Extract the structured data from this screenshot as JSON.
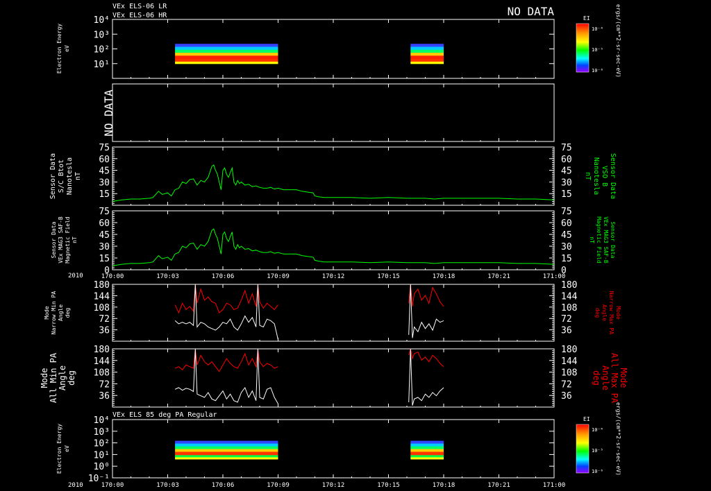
{
  "header": {
    "titles": [
      "VEx ELS-06 LR",
      "VEx ELS-06 HR"
    ],
    "no_data_label": "NO DATA",
    "bottom_title": "VEx ELS 85 deg PA Regular"
  },
  "colors": {
    "background": "#000000",
    "foreground": "#ffffff",
    "mag_trace": "#00ff00",
    "max_pa_trace": "#ff0000",
    "min_pa_trace": "#ffffff"
  },
  "colorbars": {
    "label": "EI",
    "ticks_top": [
      "10⁻⁴",
      "10⁻⁵",
      "10⁻⁶"
    ],
    "ticks_bottom": [
      "10⁻⁴",
      "10⁻⁵",
      "10⁻⁶"
    ],
    "units": "ergs/(cm**2-sr-sec-eV)"
  },
  "time_axis": {
    "year": "2010",
    "ticks": [
      "170:00",
      "170:03",
      "170:06",
      "170:09",
      "170:12",
      "170:15",
      "170:18",
      "170:21",
      "171:00"
    ]
  },
  "chart_data": [
    {
      "id": "els-lr-hr",
      "type": "heatmap",
      "ylabel": [
        "Electron Energy",
        "eV"
      ],
      "ytick_labels": [
        "10⁴",
        "10³",
        "10²",
        "10¹"
      ],
      "ylim": [
        1,
        10000
      ],
      "ylog": true,
      "blocks": [
        {
          "t_start": 3.4,
          "t_end": 9.0,
          "e_min": 10,
          "e_max": 220
        },
        {
          "t_start": 16.2,
          "t_end": 18.0,
          "e_min": 10,
          "e_max": 220
        }
      ]
    },
    {
      "id": "no-data-panel",
      "type": "table",
      "ylabel": [
        "NO DATA"
      ],
      "values": []
    },
    {
      "id": "sc-btot",
      "type": "line",
      "ylabel": [
        "Sensor Data",
        "S/C Btot",
        "Nanotesla",
        "nT"
      ],
      "ylabel_right": [
        "Sensor Data",
        "VSO B",
        "Nanotesla",
        "nT"
      ],
      "ytick_labels_left": [
        "75",
        "60",
        "45",
        "30",
        "15"
      ],
      "ytick_labels_right": [
        "75",
        "60",
        "45",
        "30",
        "15"
      ],
      "ylim": [
        0,
        75
      ],
      "x": [
        0,
        0.5,
        1,
        1.5,
        2,
        2.2,
        2.5,
        2.7,
        3,
        3.2,
        3.4,
        3.6,
        3.8,
        4,
        4.2,
        4.4,
        4.6,
        4.8,
        5,
        5.2,
        5.4,
        5.5,
        5.6,
        5.7,
        5.8,
        5.9,
        6,
        6.1,
        6.2,
        6.3,
        6.4,
        6.5,
        6.6,
        6.7,
        6.8,
        6.9,
        7,
        7.2,
        7.4,
        7.6,
        7.8,
        8,
        8.2,
        8.4,
        8.6,
        8.8,
        9,
        9.3,
        9.6,
        10,
        10.3,
        10.6,
        10.9,
        11,
        11.2,
        11.5,
        12,
        13,
        14,
        15,
        16,
        16.5,
        17,
        17.5,
        18,
        19,
        20,
        21,
        22,
        23,
        24
      ],
      "values": [
        5,
        7,
        8,
        8,
        9,
        10,
        18,
        14,
        16,
        12,
        20,
        22,
        30,
        28,
        33,
        34,
        26,
        32,
        30,
        36,
        50,
        52,
        45,
        40,
        30,
        20,
        45,
        48,
        40,
        36,
        42,
        48,
        30,
        26,
        32,
        28,
        30,
        26,
        27,
        24,
        25,
        23,
        22,
        22,
        23,
        21,
        22,
        20,
        20,
        20,
        18,
        17,
        16,
        12,
        11,
        10,
        10,
        10,
        9,
        10,
        9,
        9,
        9,
        8,
        9,
        9,
        9,
        9,
        8,
        8,
        7
      ]
    },
    {
      "id": "mag-saf-b",
      "type": "line",
      "ylabel": [
        "Sensor Data",
        "VEx MAG3 SAF-B",
        "Magnetic Field",
        "nT"
      ],
      "ylabel_right": [
        "Sensor Data",
        "VEx MAG3 SAF-B",
        "Magnetic Field",
        "nT"
      ],
      "ytick_labels_left": [
        "75",
        "60",
        "45",
        "30",
        "15",
        "0"
      ],
      "ytick_labels_right": [
        "75",
        "60",
        "45",
        "30",
        "15",
        "0"
      ],
      "ylim": [
        0,
        75
      ],
      "x": [
        0,
        0.5,
        1,
        1.5,
        2,
        2.2,
        2.5,
        2.7,
        3,
        3.2,
        3.4,
        3.6,
        3.8,
        4,
        4.2,
        4.4,
        4.6,
        4.8,
        5,
        5.2,
        5.4,
        5.5,
        5.6,
        5.7,
        5.8,
        5.9,
        6,
        6.1,
        6.2,
        6.3,
        6.4,
        6.5,
        6.6,
        6.7,
        6.8,
        6.9,
        7,
        7.2,
        7.4,
        7.6,
        7.8,
        8,
        8.2,
        8.4,
        8.6,
        8.8,
        9,
        9.3,
        9.6,
        10,
        10.3,
        10.6,
        10.9,
        11,
        11.2,
        11.5,
        12,
        13,
        14,
        15,
        16,
        16.5,
        17,
        17.5,
        18,
        19,
        20,
        21,
        22,
        23,
        24
      ],
      "values": [
        5,
        7,
        8,
        8,
        9,
        10,
        18,
        14,
        16,
        12,
        20,
        22,
        30,
        28,
        33,
        34,
        26,
        32,
        30,
        36,
        50,
        52,
        45,
        40,
        30,
        20,
        45,
        48,
        40,
        36,
        42,
        48,
        30,
        26,
        32,
        28,
        30,
        26,
        27,
        24,
        25,
        23,
        22,
        22,
        23,
        21,
        22,
        20,
        20,
        20,
        18,
        17,
        16,
        12,
        11,
        10,
        10,
        10,
        9,
        10,
        9,
        9,
        9,
        8,
        9,
        9,
        9,
        9,
        8,
        8,
        7
      ]
    },
    {
      "id": "narrow-pa",
      "type": "line",
      "ylabel": [
        "Mode",
        "Narrow Min PA",
        "Angle",
        "deg"
      ],
      "ylabel_right": [
        "Mode",
        "Narrow Max PA",
        "Angle",
        "deg"
      ],
      "ytick_labels_left": [
        "180",
        "144",
        "108",
        "72",
        "36"
      ],
      "ytick_labels_right": [
        "180",
        "144",
        "108",
        "72",
        "36"
      ],
      "ylim": [
        0,
        180
      ],
      "series": [
        {
          "name": "Narrow Max PA",
          "segments": [
            {
              "x": [
                3.4,
                3.6,
                3.8,
                4.0,
                4.2,
                4.4,
                4.5,
                4.6,
                4.8,
                5.0,
                5.2,
                5.4,
                5.6,
                5.8,
                6.0,
                6.2,
                6.4,
                6.6,
                6.8,
                7.0,
                7.2,
                7.4,
                7.6,
                7.8,
                7.9,
                8.0,
                8.2,
                8.4,
                8.6,
                8.8,
                9.0
              ],
              "values": [
                115,
                90,
                120,
                100,
                110,
                95,
                180,
                120,
                165,
                130,
                140,
                125,
                120,
                90,
                100,
                120,
                115,
                100,
                105,
                130,
                160,
                120,
                150,
                110,
                180,
                125,
                105,
                120,
                110,
                100,
                115
              ]
            },
            {
              "x": [
                16.1,
                16.2,
                16.3,
                16.4,
                16.6,
                16.8,
                17.0,
                17.2,
                17.4,
                17.6,
                17.8,
                18.0
              ],
              "values": [
                120,
                180,
                110,
                150,
                165,
                130,
                145,
                120,
                170,
                150,
                125,
                110
              ]
            }
          ]
        },
        {
          "name": "Narrow Min PA",
          "segments": [
            {
              "x": [
                3.4,
                3.6,
                3.8,
                4.0,
                4.2,
                4.4,
                4.5,
                4.6,
                4.8,
                5.0,
                5.2,
                5.4,
                5.6,
                5.8,
                6.0,
                6.2,
                6.4,
                6.6,
                6.8,
                7.0,
                7.2,
                7.4,
                7.6,
                7.8,
                7.9,
                8.0,
                8.2,
                8.4,
                8.6,
                8.8,
                9.0
              ],
              "values": [
                65,
                55,
                60,
                55,
                60,
                50,
                180,
                45,
                60,
                55,
                45,
                40,
                35,
                45,
                60,
                55,
                70,
                45,
                35,
                55,
                80,
                60,
                75,
                45,
                180,
                50,
                45,
                70,
                65,
                55,
                5
              ]
            },
            {
              "x": [
                16.1,
                16.2,
                16.3,
                16.4,
                16.6,
                16.8,
                17.0,
                17.2,
                17.4,
                17.6,
                17.8,
                18.0
              ],
              "values": [
                20,
                180,
                10,
                45,
                30,
                60,
                40,
                55,
                35,
                70,
                60,
                65
              ]
            }
          ]
        }
      ]
    },
    {
      "id": "all-pa",
      "type": "line",
      "ylabel": [
        "Mode",
        "All Min PA",
        "Angle",
        "deg"
      ],
      "ylabel_right": [
        "Mode",
        "All Max PA",
        "Angle",
        "deg"
      ],
      "ytick_labels_left": [
        "180",
        "144",
        "108",
        "72",
        "36"
      ],
      "ytick_labels_right": [
        "180",
        "144",
        "108",
        "72",
        "36"
      ],
      "ylim": [
        0,
        180
      ],
      "series": [
        {
          "name": "All Max PA",
          "segments": [
            {
              "x": [
                3.4,
                3.6,
                3.8,
                4.0,
                4.2,
                4.4,
                4.5,
                4.6,
                4.8,
                5.0,
                5.2,
                5.4,
                5.6,
                5.8,
                6.0,
                6.2,
                6.4,
                6.6,
                6.8,
                7.0,
                7.2,
                7.4,
                7.6,
                7.8,
                7.9,
                8.0,
                8.2,
                8.4,
                8.6,
                8.8,
                9.0
              ],
              "values": [
                120,
                125,
                115,
                130,
                125,
                120,
                180,
                130,
                160,
                140,
                130,
                140,
                125,
                110,
                130,
                150,
                135,
                125,
                120,
                140,
                165,
                130,
                150,
                125,
                180,
                140,
                125,
                135,
                130,
                120,
                125
              ]
            },
            {
              "x": [
                16.1,
                16.2,
                16.3,
                16.4,
                16.6,
                16.8,
                17.0,
                17.2,
                17.4,
                17.6,
                17.8,
                18.0
              ],
              "values": [
                160,
                180,
                150,
                165,
                170,
                145,
                155,
                140,
                160,
                150,
                135,
                125
              ]
            }
          ]
        },
        {
          "name": "All Min PA",
          "segments": [
            {
              "x": [
                3.4,
                3.6,
                3.8,
                4.0,
                4.2,
                4.4,
                4.5,
                4.6,
                4.8,
                5.0,
                5.2,
                5.4,
                5.6,
                5.8,
                6.0,
                6.2,
                6.4,
                6.6,
                6.8,
                7.0,
                7.2,
                7.4,
                7.6,
                7.8,
                7.9,
                8.0,
                8.2,
                8.4,
                8.6,
                8.8,
                9.0
              ],
              "values": [
                55,
                60,
                52,
                58,
                55,
                48,
                180,
                40,
                35,
                30,
                45,
                25,
                20,
                35,
                50,
                25,
                40,
                20,
                15,
                45,
                60,
                30,
                50,
                20,
                180,
                30,
                25,
                55,
                60,
                30,
                10
              ]
            },
            {
              "x": [
                16.1,
                16.2,
                16.3,
                16.4,
                16.6,
                16.8,
                17.0,
                17.2,
                17.4,
                17.6,
                17.8,
                18.0
              ],
              "values": [
                15,
                180,
                5,
                25,
                30,
                20,
                40,
                30,
                45,
                35,
                50,
                60
              ]
            }
          ]
        }
      ]
    },
    {
      "id": "els-85-pa",
      "type": "heatmap",
      "ylabel": [
        "Electron Energy",
        "eV"
      ],
      "ytick_labels": [
        "10⁴",
        "10³",
        "10²",
        "10¹",
        "10⁰",
        "10⁻¹"
      ],
      "ylim": [
        0.1,
        10000
      ],
      "ylog": true,
      "blocks": [
        {
          "t_start": 3.4,
          "t_end": 9.0,
          "e_min": 4,
          "e_max": 150
        },
        {
          "t_start": 16.2,
          "t_end": 18.0,
          "e_min": 4,
          "e_max": 150
        }
      ]
    }
  ]
}
